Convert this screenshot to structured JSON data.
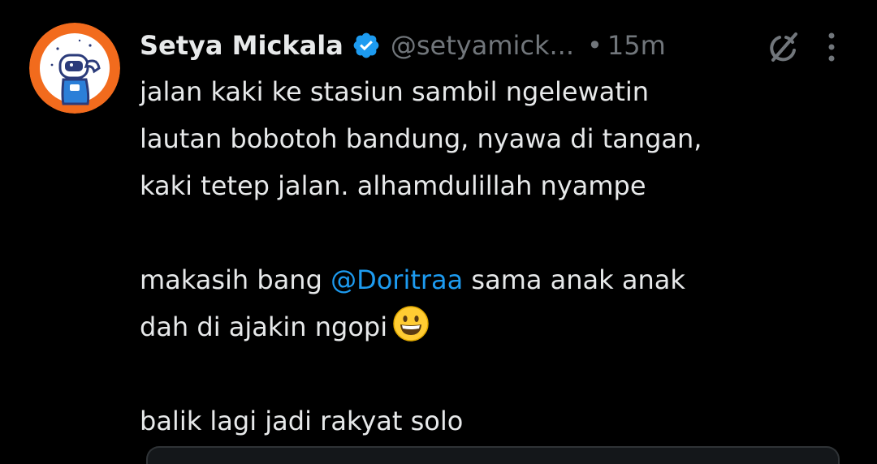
{
  "tweet": {
    "author": {
      "display_name": "Setya Mickala",
      "handle": "@setyamick...",
      "verified": true,
      "avatar_icon": "astronaut-avatar"
    },
    "separator": "•",
    "timestamp": "15m",
    "lines": [
      "jalan kaki ke stasiun sambil ngelewatin",
      "lautan bobotoh bandung, nyawa di tangan,",
      "kaki tetep jalan. alhamdulillah nyampe"
    ],
    "thanks_prefix": "makasih bang ",
    "mention": "@Doritraa",
    "thanks_suffix": " sama anak anak",
    "coffee_line": "dah di ajakin ngopi",
    "emoji": "grinning-face",
    "closing_line": "balik lagi jadi rakyat solo"
  },
  "colors": {
    "background": "#000000",
    "text": "#e7e9ea",
    "muted": "#71767b",
    "accent": "#1d9bf0",
    "avatar_bg": "#f26b1d"
  },
  "icons": {
    "verified": "verified-badge-icon",
    "grok": "grok-icon",
    "more": "more-options-icon"
  }
}
